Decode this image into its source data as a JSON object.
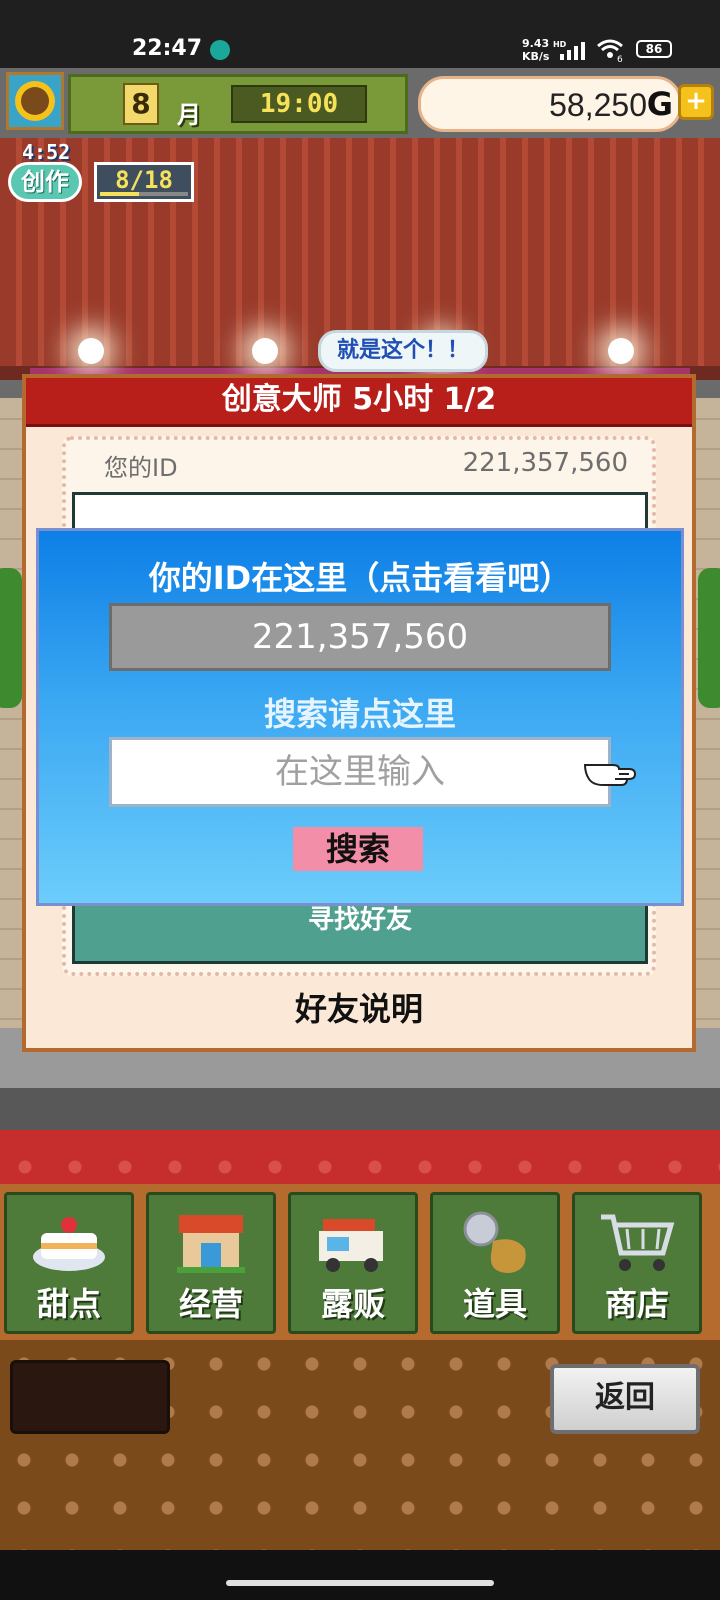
{
  "status_bar": {
    "time": "22:47",
    "network_speed_value": "9.43",
    "network_speed_unit": "KB/s",
    "network_tag": "HD",
    "wifi_sub": "6",
    "battery": "86"
  },
  "hud": {
    "month": "8",
    "month_label": "月",
    "clock": "19:00",
    "money": "58,250",
    "money_unit": "G",
    "create_timer": "4:52",
    "create_label": "创作",
    "create_progress": "8/18",
    "create_progress_fraction": 0.44
  },
  "tooltip": "就是这个！！",
  "friend_panel": {
    "title": "创意大师  5小时 1/2",
    "id_label": "您的ID",
    "id_value": "221,357,560",
    "find_friends": "寻找好友",
    "explain": "好友说明"
  },
  "search_dialog": {
    "heading": "你的ID在这里（点击看看吧）",
    "id_display": "221,357,560",
    "hint": "搜索请点这里",
    "input_placeholder": "在这里输入",
    "search_button": "搜索"
  },
  "menu": {
    "items": [
      {
        "label": "甜点",
        "icon": "cake-icon"
      },
      {
        "label": "经营",
        "icon": "shop-icon"
      },
      {
        "label": "露贩",
        "icon": "food-truck-icon"
      },
      {
        "label": "道具",
        "icon": "items-bag-icon"
      },
      {
        "label": "商店",
        "icon": "cart-icon"
      }
    ]
  },
  "back_button": "返回",
  "colors": {
    "dialog_top": "#0d7fe6",
    "dialog_bottom": "#6ccdfb",
    "title_red": "#b81f1a",
    "search_button": "#f38ea8",
    "menu_green": "#4e7a3a"
  }
}
